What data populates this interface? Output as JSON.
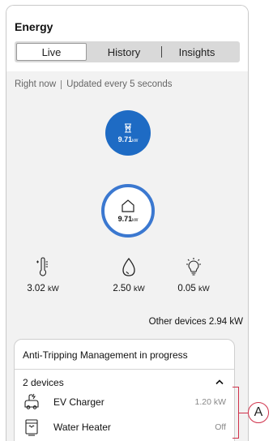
{
  "header": {
    "title": "Energy",
    "tabs": {
      "live": "Live",
      "history": "History",
      "insights": "Insights"
    }
  },
  "status": {
    "now": "Right now",
    "updated": "Updated every 5 seconds"
  },
  "solar": {
    "value": "9.71",
    "unit": "kW"
  },
  "home": {
    "value": "9.71",
    "unit": "kW"
  },
  "categories": [
    {
      "icon": "thermometer-icon",
      "value": "3.02",
      "unit": "kW"
    },
    {
      "icon": "water-drop-icon",
      "value": "2.50",
      "unit": "kW"
    },
    {
      "icon": "lightbulb-icon",
      "value": "0.05",
      "unit": "kW"
    }
  ],
  "other_devices": "Other devices 2.94 kW",
  "atm_card": {
    "title": "Anti-Tripping Management in progress",
    "device_count": "2 devices",
    "items": [
      {
        "icon": "ev-charger-icon",
        "name": "EV Charger",
        "reading": "1.20 kW"
      },
      {
        "icon": "water-heater-icon",
        "name": "Water Heater",
        "reading": "Off"
      }
    ]
  },
  "callout": {
    "label": "A"
  },
  "colors": {
    "solar_fill": "#1e6bc4",
    "home_ring": "#3b78d0",
    "callout": "#d0324b"
  }
}
